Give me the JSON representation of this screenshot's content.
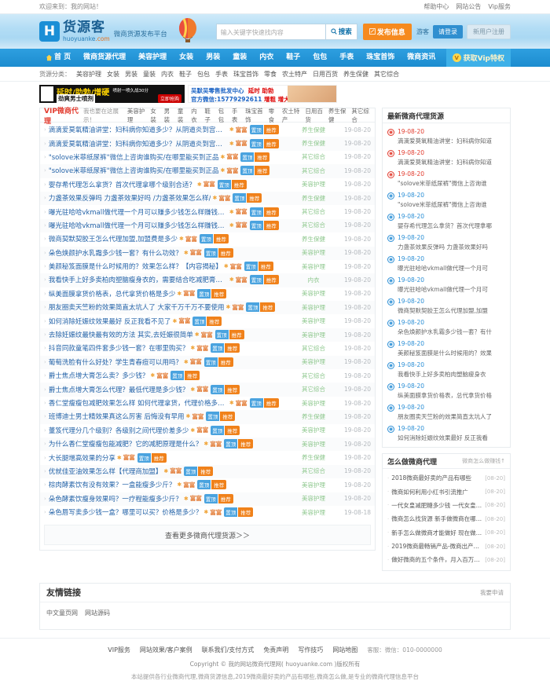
{
  "topbar": {
    "welcome": "欢迎来到：我的网站！",
    "links": [
      "帮助中心",
      "网站公告",
      "Vip服务"
    ]
  },
  "header": {
    "logo_mark": "H",
    "logo_title": "货源客",
    "logo_sub_main": "huoyuanke",
    "logo_sub_dom": ".com",
    "slogan": "微商货源发布平台",
    "search_placeholder": "输入关键字快速找内容",
    "search_value": "",
    "search_button": "搜索",
    "search_icon": "search-icon",
    "publish_button": "发布信息",
    "publish_icon": "edit-icon",
    "user_guest": "游客",
    "login_button": "请登录",
    "register_button": "新用户注册"
  },
  "nav": {
    "items": [
      "首 页",
      "微商货源代理",
      "美容护理",
      "女装",
      "男装",
      "童装",
      "内衣",
      "鞋子",
      "包包",
      "手表",
      "珠宝首饰",
      "微商资讯"
    ],
    "vip_label": "获取Vip特权",
    "vip_icon": "diamond-icon",
    "home_icon": "home-icon"
  },
  "subnav": {
    "label": "货源分类：",
    "items": [
      "美容护理",
      "女装",
      "男装",
      "童装",
      "内衣",
      "鞋子",
      "包包",
      "手表",
      "珠宝首饰",
      "零食",
      "农土特产",
      "日用百货",
      "养生保健",
      "其它综合"
    ]
  },
  "ads": {
    "ad1": {
      "title": "延时/助勃/增硬",
      "sub": "劲爽男士喷剂",
      "note": "喷射一喷久战30分",
      "cta": "立即抢购"
    },
    "ad2": {
      "line1_a": "吴默吴零售批发中心",
      "line1_b": "延时 助勃",
      "line2_a": "官方微信:15779292611",
      "line2_b": "增粗 增大"
    }
  },
  "vip_panel": {
    "title": "VIP微商代理",
    "subtitle": "我也要在这展示！",
    "categories": [
      "美容护理",
      "女装",
      "男装",
      "童装",
      "内衣",
      "鞋子",
      "包包",
      "手表",
      "珠宝首饰",
      "零食",
      "农土特产",
      "日用百货",
      "养生保健",
      "其它综合"
    ],
    "badge_blue": "置顶",
    "badge_orange": "推荐",
    "gift_label": "富富",
    "more_label": "查看更多微商代理货源＞＞",
    "rows": [
      {
        "title": "滴滴爱莫氧精油讲堂：妇科病你知道多少？从阴道炎到宫颈糜只有三",
        "cat": "养生保健",
        "date": "19-08-20"
      },
      {
        "title": "滴滴爱莫氧精油讲堂：妇科病你知道多少？从阴道炎到宫颈糜只有三",
        "cat": "养生保健",
        "date": "19-08-20"
      },
      {
        "title": "\"solove米菲纸尿裤\"微信上咨询谁购买/在哪里能买到正品",
        "cat": "其它综合",
        "date": "19-08-20"
      },
      {
        "title": "\"solove米菲纸尿裤\"微信上咨询谁购买/在哪里能买到正品",
        "cat": "其它综合",
        "date": "19-08-20"
      },
      {
        "title": "婴存希代理怎么拿货？首次代理拿哪个级别合适？",
        "cat": "美容护理",
        "date": "19-08-20"
      },
      {
        "title": "力盏茶效果反弹吗 力盏茶效果好吗 /力盏茶效果怎么样/",
        "cat": "养生保健",
        "date": "19-08-20"
      },
      {
        "title": "曝光驻哈哈vkmall做代理一个月可以赚多少钱怎么样赚钱利润",
        "cat": "其它综合",
        "date": "19-08-20"
      },
      {
        "title": "曝光驻哈哈vkmall做代理一个月可以赚多少钱怎么样赚钱利润",
        "cat": "其它综合",
        "date": "19-08-20"
      },
      {
        "title": "微商契默契胶王怎么代理加盟,加盟费是多少",
        "cat": "养生保健",
        "date": "19-08-20"
      },
      {
        "title": "朵色焕颜护水乳霜多少钱一套？有什么功效？",
        "cat": "美容护理",
        "date": "19-08-20"
      },
      {
        "title": "美颜秘笈面膜是什么时候用的？效果怎么样？【内容揭秘】",
        "cat": "美容护理",
        "date": "19-08-20"
      },
      {
        "title": "我看快手上好多卖柏肉塑脑瘦身衣的，需要结合吃减肥膏谱去穿吗？",
        "cat": "内衣",
        "date": "19-08-20"
      },
      {
        "title": "纵美面膜拿货价格表，总代拿货价格是多少",
        "cat": "美容护理",
        "date": "19-08-20"
      },
      {
        "title": "朋友圈卖天竺粉的效果简直太坑人了 大家千万千万不要使用",
        "cat": "美容护理",
        "date": "19-08-20"
      },
      {
        "title": "如何消除妊娠纹效果最好 反正我看不见了",
        "cat": "美容护理",
        "date": "19-08-20"
      },
      {
        "title": "去除妊娠纹最快最有效的方法 其实,去妊娠很简单",
        "cat": "美容护理",
        "date": "19-08-20"
      },
      {
        "title": "抖音同款童笔四件套多少钱一套？在哪里购买？",
        "cat": "其它综合",
        "date": "19-08-20"
      },
      {
        "title": "葡萄洗脸有什么好处？学生青春痘可以用吗？",
        "cat": "美容护理",
        "date": "19-08-20"
      },
      {
        "title": "爵士焦点增大膏怎么卖？多少钱？",
        "cat": "其它综合",
        "date": "19-08-20"
      },
      {
        "title": "爵士焦点增大膏怎么代理？最低代理是多少钱？",
        "cat": "其它综合",
        "date": "19-08-20"
      },
      {
        "title": "香仁堂瘦瘦包减肥效果怎么样 如何代理拿货，代理价格多少钱？有",
        "cat": "美容护理",
        "date": "19-08-20"
      },
      {
        "title": "班博迪士男士精效果真这么厉害 后悔没有早用",
        "cat": "养生保健",
        "date": "19-08-20"
      },
      {
        "title": "董笈代理分几个级别？各级别之间代理价差多少",
        "cat": "美容护理",
        "date": "19-08-20"
      },
      {
        "title": "为什么香仁堂瘦瘦包能减肥？它的减肥原理是什么？",
        "cat": "美容护理",
        "date": "19-08-20"
      },
      {
        "title": "大长腿增高效果的分享",
        "cat": "养生保健",
        "date": "19-08-20"
      },
      {
        "title": "优就佳亚油效果怎么样【代理商加盟】",
        "cat": "其它综合",
        "date": "19-08-20"
      },
      {
        "title": "棕肉酵素饮有没有效果？一盒能瘦多少斤？",
        "cat": "美容护理",
        "date": "19-08-20"
      },
      {
        "title": "朵色酵素饮瘦身效果吗？一疗程能瘦多少斤？",
        "cat": "美容护理",
        "date": "19-08-20"
      },
      {
        "title": "朵色唇写卖多少钱一盒？哪里可以买？价格是多少？",
        "cat": "美容护理",
        "date": "19-08-18"
      }
    ]
  },
  "news_panel": {
    "title": "最新微商代理货源",
    "items": [
      {
        "date": "19-08-20",
        "title": "滴滴爱莫氧精油讲堂：妇科病你知道",
        "color": "red"
      },
      {
        "date": "19-08-20",
        "title": "滴滴爱莫氧精油讲堂：妇科病你知道",
        "color": "red"
      },
      {
        "date": "19-08-20",
        "title": "\"solove米菲纸尿裤\"微信上咨询谁",
        "color": "red"
      },
      {
        "date": "19-08-20",
        "title": "\"solove米菲纸尿裤\"微信上咨询谁",
        "color": "blue"
      },
      {
        "date": "19-08-20",
        "title": "婴存希代理怎么拿货？首次代理拿哪",
        "color": "blue"
      },
      {
        "date": "19-08-20",
        "title": "力盏茶效果反弹吗 力盏茶效果好吗",
        "color": "blue"
      },
      {
        "date": "19-08-20",
        "title": "曝光驻哈哈vkmall做代理一个月可",
        "color": "blue"
      },
      {
        "date": "19-08-20",
        "title": "曝光驻哈哈vkmall做代理一个月可",
        "color": "blue"
      },
      {
        "date": "19-08-20",
        "title": "微商契默契胶王怎么代理加盟,加盟",
        "color": "blue"
      },
      {
        "date": "19-08-20",
        "title": "朵色焕颜护水乳霜多少钱一套？有什",
        "color": "blue"
      },
      {
        "date": "19-08-20",
        "title": "美颜秘笈面膜是什么时候用的？效果",
        "color": "blue"
      },
      {
        "date": "19-08-20",
        "title": "我看快手上好多卖柏肉塑脑瘦身衣",
        "color": "blue"
      },
      {
        "date": "19-08-20",
        "title": "纵美面膜拿货价格表，总代拿货价格",
        "color": "blue"
      },
      {
        "date": "19-08-20",
        "title": "朋友圈卖天竺粉的效果简直太坑人了",
        "color": "blue"
      },
      {
        "date": "19-08-20",
        "title": "如何消除妊娠纹效果最好 反正我看",
        "color": "blue"
      }
    ]
  },
  "article_panel": {
    "title": "怎么做微商代理",
    "more": "微商怎么做赚钱↑",
    "items": [
      {
        "title": "2018微商最好卖的产品有哪些",
        "date": "[08-20]"
      },
      {
        "title": "微商如何利用小红书引流推广",
        "date": "[08-20]"
      },
      {
        "title": "一代女皇减肥糖多少钱 一代女皇吃了9种...",
        "date": "[08-20]"
      },
      {
        "title": "微商怎么找货源 新手做微商在哪里拿货源",
        "date": "[08-20]"
      },
      {
        "title": "新手怎么做微商才能做好 现在做微商还...",
        "date": "[08-20]"
      },
      {
        "title": "2019微商最畅销产品-微商出产品会全微...",
        "date": "[08-20]"
      },
      {
        "title": "做好微商的五个条件，月入百万不是梦",
        "date": "[08-20]"
      }
    ]
  },
  "links_panel": {
    "title": "友情链接",
    "more": "我要申请",
    "items": [
      "中文童页网",
      "网站源码"
    ]
  },
  "footer": {
    "nav": [
      "VIP服务",
      "网站效果/客户案例",
      "联系我们/支付方式",
      "免责声明",
      "写作技巧",
      "网站地图"
    ],
    "service": "客服：微信：010-0000000",
    "copyright_pre": "Copyright © 我的网站微商代理网( ",
    "copyright_link": "huoyuanke.com",
    "copyright_post": " )版权所有",
    "description": "本站提供各行业微商代理,微商货源信息,2019微商最好卖的产品有哪些,微商怎么做,是专业的微商代理信息平台"
  }
}
